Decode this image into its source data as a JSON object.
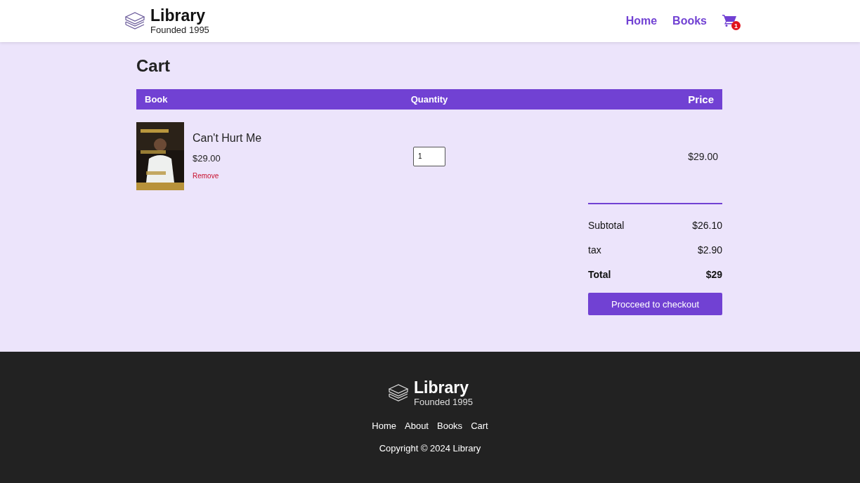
{
  "header": {
    "logo": {
      "title": "Library",
      "subtitle": "Founded 1995"
    },
    "nav": [
      "Home",
      "Books"
    ],
    "cart_count": "1"
  },
  "page_title": "Cart",
  "table": {
    "columns": [
      "Book",
      "Quantity",
      "Price"
    ],
    "rows": [
      {
        "title": "Can't Hurt Me",
        "price": "$29.00",
        "remove": "Remove",
        "quantity": "1",
        "total": "$29.00"
      }
    ]
  },
  "summary": {
    "rows": [
      {
        "label": "Subtotal",
        "value": "$26.10",
        "bold": false
      },
      {
        "label": "tax",
        "value": "$2.90",
        "bold": false
      },
      {
        "label": "Total",
        "value": "$29",
        "bold": true
      }
    ],
    "button": "Procceed to checkout"
  },
  "footer": {
    "logo": {
      "title": "Library",
      "subtitle": "Founded 1995"
    },
    "links": [
      "Home",
      "About",
      "Books",
      "Cart"
    ],
    "copyright": "Copyright © 2024 Library"
  }
}
